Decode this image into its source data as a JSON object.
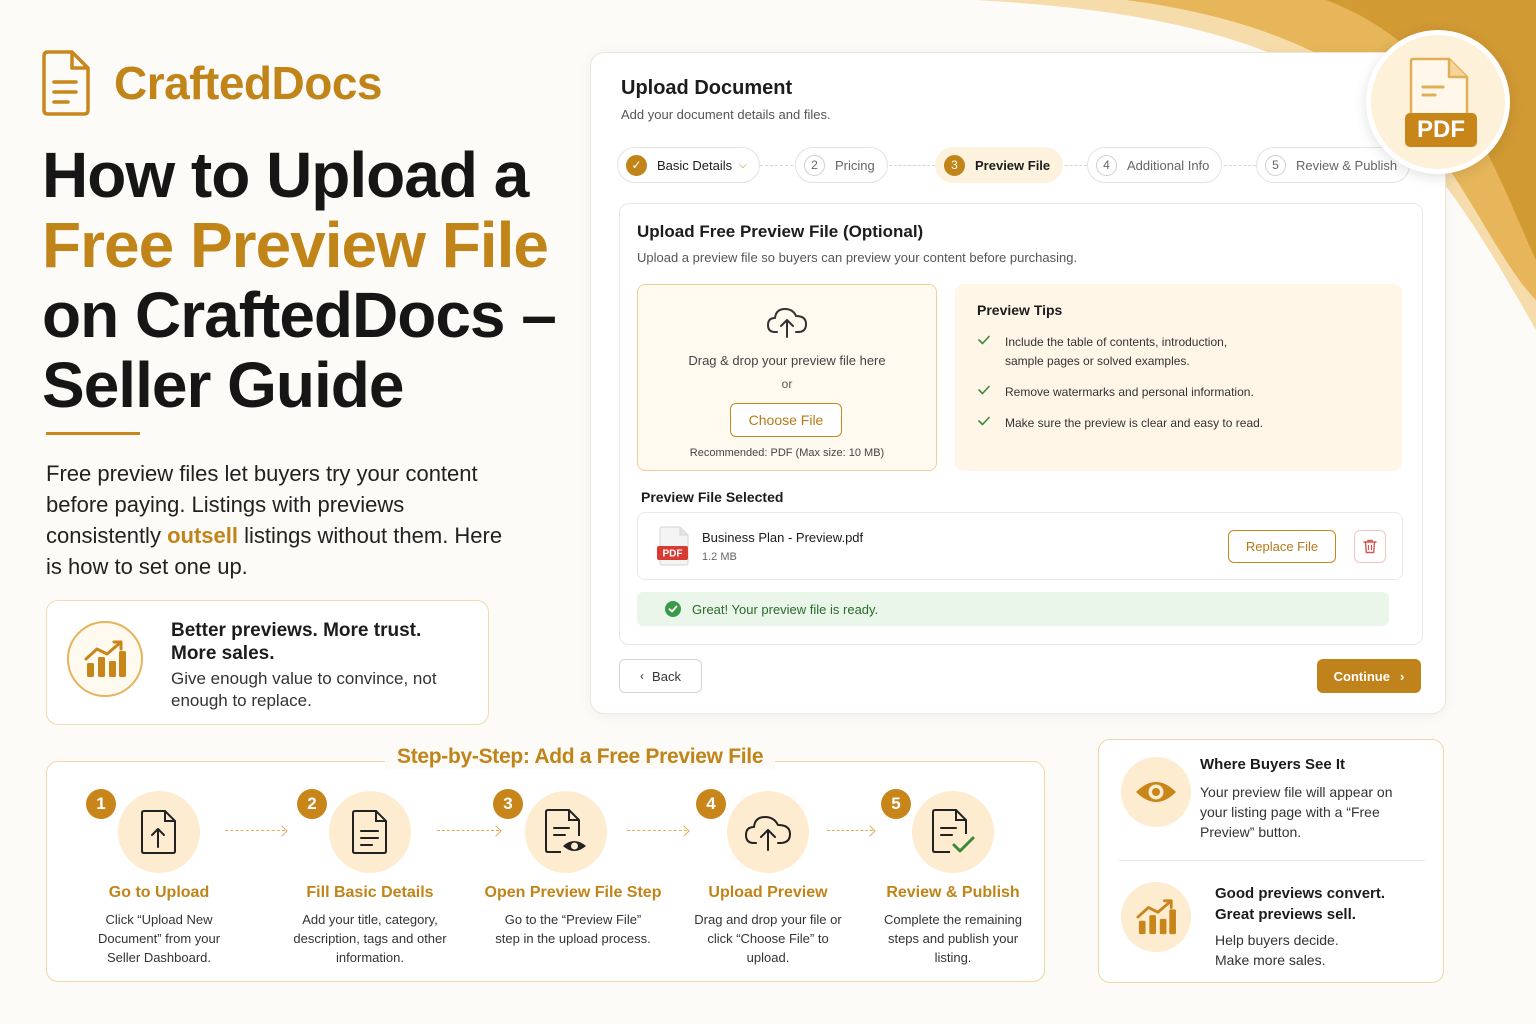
{
  "brand": {
    "name": "CraftedDocs"
  },
  "hero": {
    "title_line1": "How to Upload a",
    "title_line2": "Free Preview File",
    "title_line3": "on CraftedDocs –",
    "title_line4": "Seller Guide",
    "intro_before": "Free preview files let buyers try your content before paying. Listings with previews consistently",
    "intro_highlight": "outsell",
    "intro_after": "listings without them. Here is how to set one up."
  },
  "trust": {
    "heading": "Better previews. More trust. More sales.",
    "text": "Give enough value to convince, not enough to replace."
  },
  "pdf_badge": {
    "label": "PDF"
  },
  "upload": {
    "title": "Upload Document",
    "subtitle": "Add your document details and files.",
    "steps": [
      {
        "num": "✓",
        "label": "Basic Details",
        "state": "done"
      },
      {
        "num": "2",
        "label": "Pricing",
        "state": "todo"
      },
      {
        "num": "3",
        "label": "Preview File",
        "state": "active"
      },
      {
        "num": "4",
        "label": "Additional Info",
        "state": "todo"
      },
      {
        "num": "5",
        "label": "Review & Publish",
        "state": "todo"
      }
    ],
    "card_title": "Upload Free Preview File (Optional)",
    "card_subtitle": "Upload a preview file so buyers can preview your content before purchasing.",
    "drop_text": "Drag & drop your preview file here",
    "drop_or": "or",
    "choose_label": "Choose File",
    "recommended": "Recommended: PDF (Max size: 10 MB)",
    "tips_heading": "Preview Tips",
    "tips": [
      "Include the table of contents, introduction, sample pages or solved examples.",
      "Remove watermarks and personal information.",
      "Make sure the preview is clear and easy to read."
    ],
    "selected_heading": "Preview File Selected",
    "file_icon_label": "PDF",
    "file_name": "Business Plan - Preview.pdf",
    "file_size": "1.2 MB",
    "replace_label": "Replace File",
    "success_text": "Great! Your preview file is ready.",
    "back_label": "Back",
    "continue_label": "Continue"
  },
  "guide": {
    "title": "Step-by-Step: Add a Free Preview File",
    "steps": [
      {
        "num": "1",
        "title": "Go to Upload",
        "desc": "Click “Upload New Document” from your Seller Dashboard.",
        "icon": "file-upload-icon"
      },
      {
        "num": "2",
        "title": "Fill Basic Details",
        "desc": "Add your title, category, description, tags and other information.",
        "icon": "document-icon"
      },
      {
        "num": "3",
        "title": "Open Preview File Step",
        "desc": "Go to the “Preview File” step in the upload process.",
        "icon": "file-preview-icon"
      },
      {
        "num": "4",
        "title": "Upload Preview",
        "desc": "Drag and drop your file or click “Choose File” to upload.",
        "icon": "cloud-upload-icon"
      },
      {
        "num": "5",
        "title": "Review & Publish",
        "desc": "Complete the remaining steps and publish your listing.",
        "icon": "file-check-icon"
      }
    ]
  },
  "where": {
    "heading": "Where Buyers See It",
    "text": "Your preview file will appear on your listing page with a “Free Preview” button.",
    "heading2": "Good previews convert. Great previews sell.",
    "text2": "Help buyers decide. Make more sales."
  },
  "colors": {
    "accent": "#c08418",
    "accent_light": "#fdecd0",
    "success": "#2a6b2a",
    "danger": "#d9534f"
  }
}
